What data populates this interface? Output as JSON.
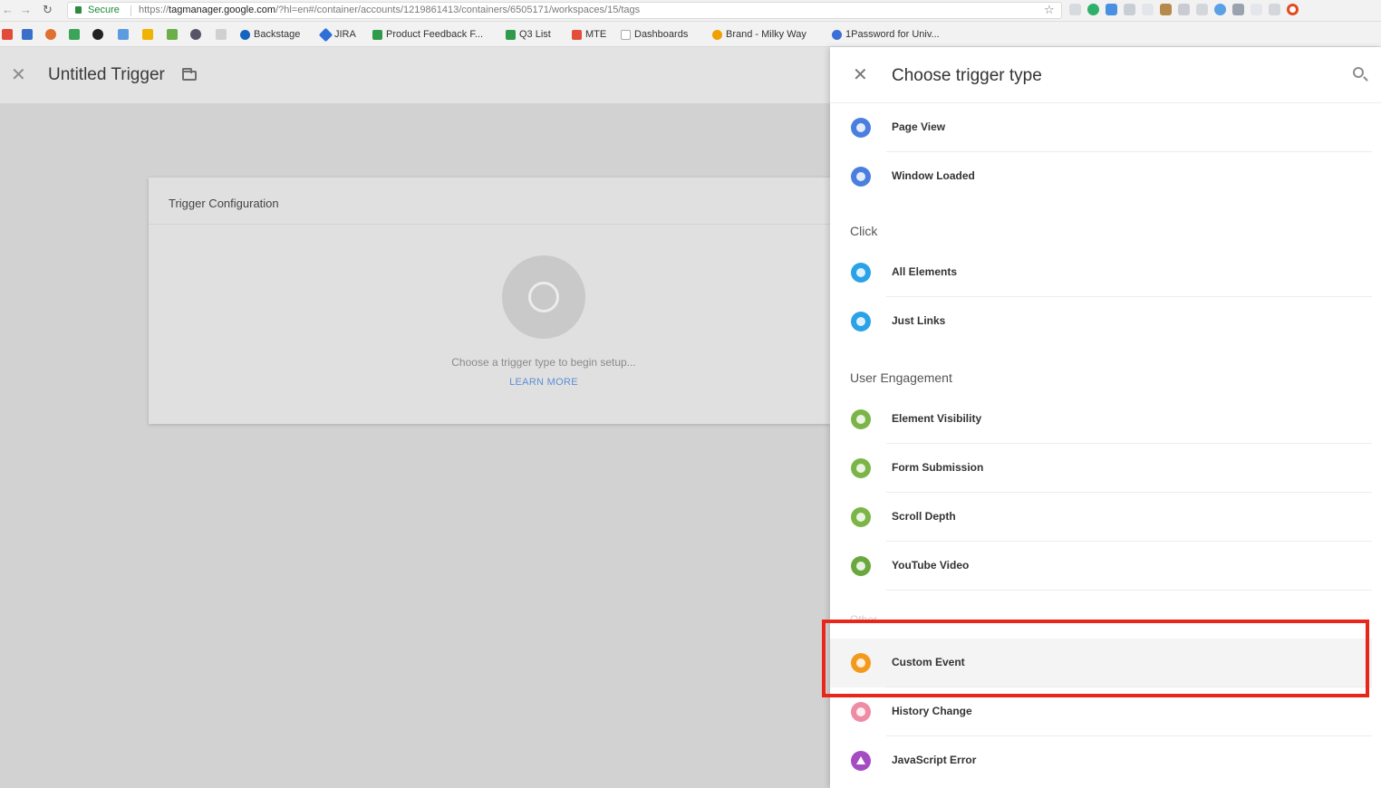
{
  "browser": {
    "address": {
      "secure_label": "Secure",
      "url_prefix": "https://",
      "url_host": "tagmanager.google.com",
      "url_path": "/?hl=en#/container/accounts/1219861413/containers/6505171/workspaces/15/tags"
    },
    "bookmarks": [
      {
        "label": "Backstage",
        "color": "#1565c0"
      },
      {
        "label": "JIRA",
        "color": "#2f6fd8"
      },
      {
        "label": "Product Feedback F...",
        "color": "#2e9b4a"
      },
      {
        "label": "Q3 List",
        "color": "#2e9b4a"
      },
      {
        "label": "MTE",
        "color": "#e44d3a"
      },
      {
        "label": "Dashboards",
        "color": "#b0b0b0"
      },
      {
        "label": "Brand - Milky Way",
        "color": "#f0a000"
      },
      {
        "label": "1Password for Univ...",
        "color": "#3b6ed6"
      }
    ]
  },
  "trigger_editor": {
    "title": "Untitled Trigger",
    "card_title": "Trigger Configuration",
    "hint": "Choose a trigger type to begin setup...",
    "learn_more": "LEARN MORE"
  },
  "panel": {
    "title": "Choose trigger type",
    "sections": [
      {
        "heading": "",
        "items": [
          {
            "label": "Page View",
            "color": "#4a7fe0",
            "icon": "eye-icon"
          },
          {
            "label": "Window Loaded",
            "color": "#4a7fe0",
            "icon": "window-icon"
          }
        ]
      },
      {
        "heading": "Click",
        "items": [
          {
            "label": "All Elements",
            "color": "#2aa2e8",
            "icon": "cursor-icon"
          },
          {
            "label": "Just Links",
            "color": "#2aa2e8",
            "icon": "link-icon"
          }
        ]
      },
      {
        "heading": "User Engagement",
        "items": [
          {
            "label": "Element Visibility",
            "color": "#7bb548",
            "icon": "visibility-icon"
          },
          {
            "label": "Form Submission",
            "color": "#7bb548",
            "icon": "form-icon"
          },
          {
            "label": "Scroll Depth",
            "color": "#7bb548",
            "icon": "scroll-icon"
          },
          {
            "label": "YouTube Video",
            "color": "#6aa83f",
            "icon": "play-icon"
          }
        ]
      },
      {
        "heading": "Other",
        "items": [
          {
            "label": "Custom Event",
            "color": "#f39a1e",
            "icon": "code-icon",
            "highlighted": true
          },
          {
            "label": "History Change",
            "color": "#ee8ba5",
            "icon": "history-icon"
          },
          {
            "label": "JavaScript Error",
            "color": "#a64cc2",
            "icon": "warning-icon"
          }
        ]
      }
    ]
  }
}
